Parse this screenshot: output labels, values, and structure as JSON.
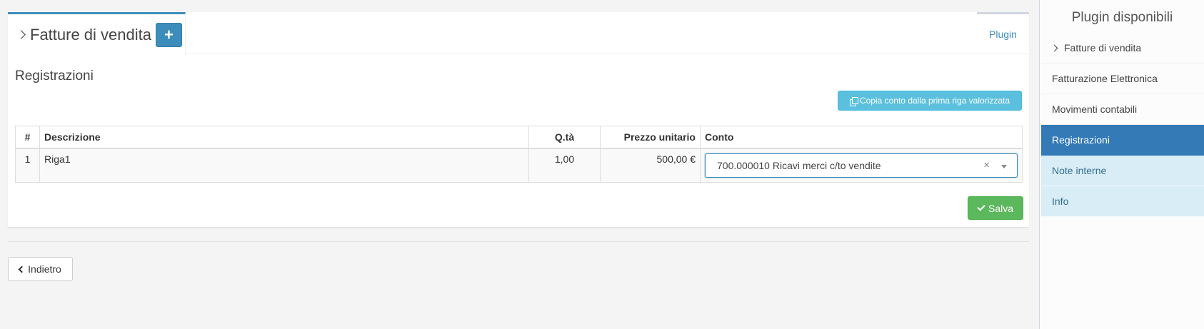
{
  "module": {
    "title": "Fatture di vendita",
    "add_label": "+",
    "plugin_tab": "Plugin"
  },
  "section": {
    "title": "Registrazioni",
    "copy_button": "Copia conto dalla prima riga valorizzata"
  },
  "table": {
    "headers": [
      "#",
      "Descrizione",
      "Q.tà",
      "Prezzo unitario",
      "Conto"
    ],
    "rows": [
      {
        "num": "1",
        "description": "Riga1",
        "qty": "1,00",
        "price": "500,00 €",
        "account": "700.000010 Ricavi merci c/to vendite",
        "clear": "×"
      }
    ]
  },
  "actions": {
    "save": "Salva",
    "back": "Indietro"
  },
  "sidebar": {
    "title": "Plugin disponibili",
    "items": [
      {
        "label": "Fatture di vendita",
        "state": "normal"
      },
      {
        "label": "Fatturazione Elettronica",
        "state": "normal"
      },
      {
        "label": "Movimenti contabili",
        "state": "normal"
      },
      {
        "label": "Registrazioni",
        "state": "active"
      },
      {
        "label": "Note interne",
        "state": "info"
      },
      {
        "label": "Info",
        "state": "info"
      }
    ]
  },
  "colors": {
    "primary": "#3c8dbc",
    "active": "#337ab7",
    "info_button": "#5bc0de",
    "success": "#5cb85c",
    "info_bg": "#d9edf7"
  }
}
